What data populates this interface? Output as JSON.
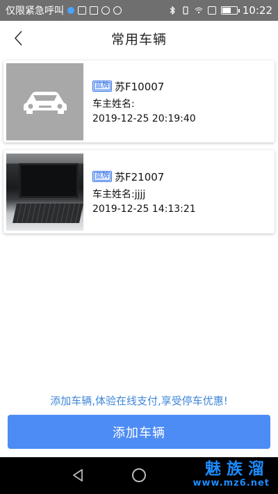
{
  "status_bar": {
    "carrier": "仅限紧急呼叫",
    "time": "10:22",
    "battery_level": 0.55,
    "icons": [
      "shield-dot-icon",
      "sim-icon",
      "image-icon",
      "blocked-icon",
      "settings-icon",
      "bluetooth-icon",
      "vibrate-icon",
      "wifi-icon",
      "data-icon",
      "battery-icon"
    ]
  },
  "header": {
    "title": "常用车辆",
    "back_icon": "chevron-left-icon"
  },
  "vehicles": [
    {
      "plate_type": "蓝牌",
      "plate": "苏F10007",
      "owner": "车主姓名:",
      "datetime": "2019-12-25 20:19:40",
      "thumbnail": "car-placeholder-icon"
    },
    {
      "plate_type": "蓝牌",
      "plate": "苏F21007",
      "owner": "车主姓名:jjjj",
      "datetime": "2019-12-25 14:13:21",
      "thumbnail": "laptop-photo"
    }
  ],
  "promo_text": "添加车辆,体验在线支付,享受停车优惠!",
  "add_button_label": "添加车辆",
  "nav": {
    "back_icon": "triangle-back-icon",
    "home_icon": "circle-home-icon"
  },
  "watermark": {
    "title": "魅族溜",
    "url": "www.mz6.net"
  },
  "colors": {
    "accent": "#4d8cf4",
    "promo": "#3f86d8",
    "status_bar": "#6f6f6f",
    "nav_bar": "#000000"
  }
}
